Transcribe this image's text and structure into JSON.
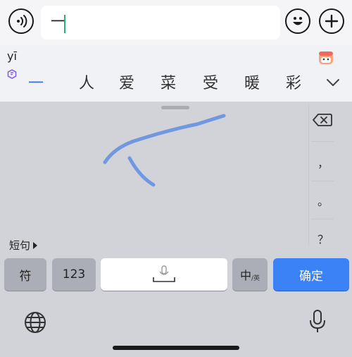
{
  "input": {
    "text": "一"
  },
  "candidate_bar": {
    "pinyin": "yī",
    "candidates": [
      "一",
      "人",
      "爱",
      "菜",
      "受",
      "暖",
      "彩"
    ]
  },
  "handwriting": {
    "stroke_color": "#6f98e0"
  },
  "side_keys": {
    "comma": "，",
    "period": "。",
    "question": "？"
  },
  "phrase": {
    "label": "短句"
  },
  "keys": {
    "symbols": "符",
    "numbers": "123",
    "zh_main": "中",
    "zh_sub": "/英",
    "confirm": "确定"
  },
  "colors": {
    "accent": "#3b82f6",
    "caret": "#22b573",
    "candidate_highlight": "#3a6edc"
  },
  "icons": [
    "voice-icon",
    "emoji-icon",
    "plus-icon",
    "brand-logo-icon",
    "mascot-icon",
    "expand-icon",
    "delete-icon",
    "mic-icon",
    "globe-icon"
  ]
}
